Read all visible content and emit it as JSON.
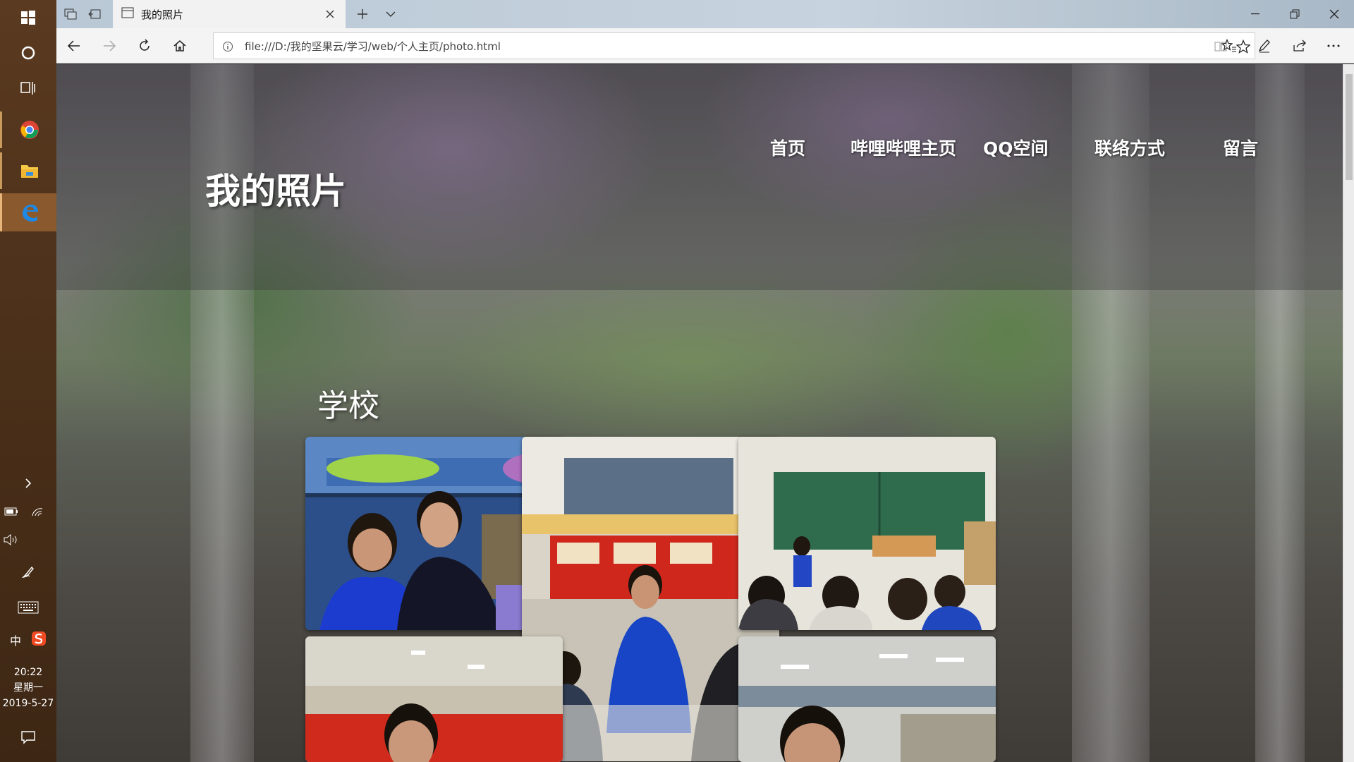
{
  "taskbar": {
    "icons": [
      "windows-start-icon",
      "cortana-icon",
      "task-view-icon",
      "chrome-icon",
      "file-explorer-icon",
      "edge-icon"
    ],
    "tray": {
      "expand_icon": "chevron-right-icon",
      "ime_label": "中",
      "time": "20:22",
      "weekday": "星期一",
      "date": "2019-5-27"
    }
  },
  "browser": {
    "tab_title": "我的照片",
    "url": "file:///D:/我的坚果云/学习/web/个人主页/photo.html"
  },
  "page": {
    "site_title": "我的照片",
    "nav": [
      "首页",
      "哔哩哔哩主页",
      "QQ空间",
      "联络方式",
      "留言"
    ],
    "section_title": "学校"
  },
  "colors": {
    "taskbar": "#4a2f19",
    "active_app": "#8a5a2e",
    "titlebar": "#c7d3de"
  }
}
